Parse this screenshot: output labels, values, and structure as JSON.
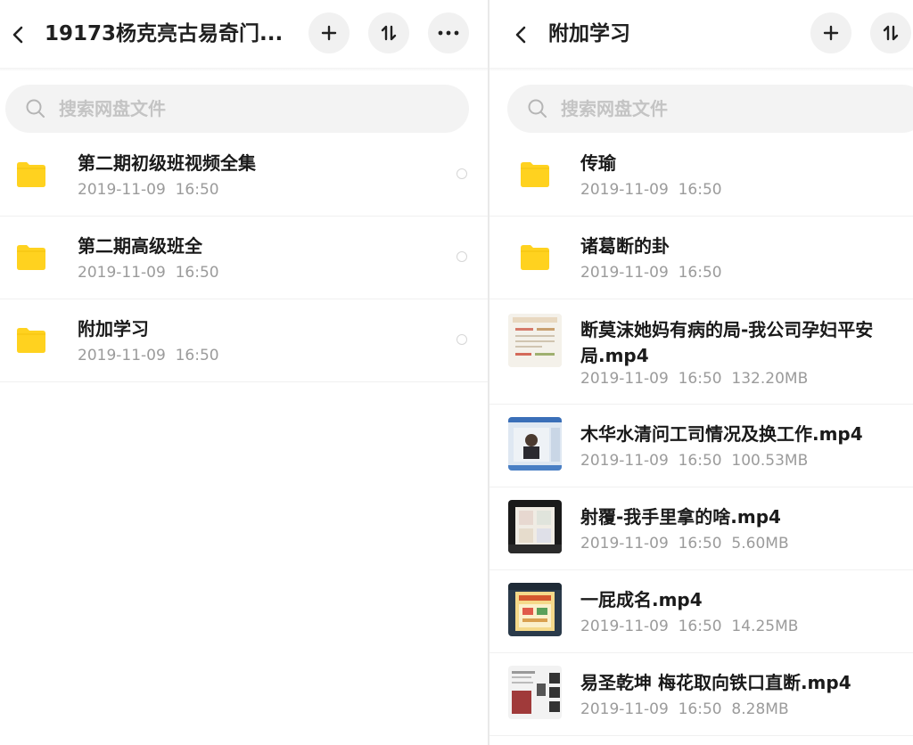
{
  "left": {
    "title": "19173杨克亮古易奇门...",
    "search_placeholder": "搜索网盘文件",
    "items": [
      {
        "name": "第二期初级班视频全集",
        "date": "2019-11-09",
        "time": "16:50"
      },
      {
        "name": "第二期高级班全",
        "date": "2019-11-09",
        "time": "16:50"
      },
      {
        "name": "附加学习",
        "date": "2019-11-09",
        "time": "16:50"
      }
    ]
  },
  "right": {
    "title": "附加学习",
    "search_placeholder": "搜索网盘文件",
    "items": [
      {
        "name": "传瑜",
        "date": "2019-11-09",
        "time": "16:50",
        "size": ""
      },
      {
        "name": "诸葛断的卦",
        "date": "2019-11-09",
        "time": "16:50",
        "size": ""
      },
      {
        "name": "断莫沫她妈有病的局-我公司孕妇平安局.mp4",
        "date": "2019-11-09",
        "time": "16:50",
        "size": "132.20MB"
      },
      {
        "name": "木华水清问工司情况及换工作.mp4",
        "date": "2019-11-09",
        "time": "16:50",
        "size": "100.53MB"
      },
      {
        "name": "射覆-我手里拿的啥.mp4",
        "date": "2019-11-09",
        "time": "16:50",
        "size": "5.60MB"
      },
      {
        "name": "一屁成名.mp4",
        "date": "2019-11-09",
        "time": "16:50",
        "size": "14.25MB"
      },
      {
        "name": "易圣乾坤 梅花取向铁口直断.mp4",
        "date": "2019-11-09",
        "time": "16:50",
        "size": "8.28MB"
      }
    ]
  },
  "icons": {
    "back": "chevron-left-icon",
    "add": "plus-icon",
    "sort": "sort-icon",
    "more": "more-horizontal-icon",
    "search": "search-icon",
    "folder": "folder-icon"
  },
  "colors": {
    "folder": "#ffd21f",
    "title_text": "#202020",
    "meta_text": "#9b9b9b",
    "button_bg": "#f1f1f1",
    "search_bg": "#f3f3f3"
  }
}
